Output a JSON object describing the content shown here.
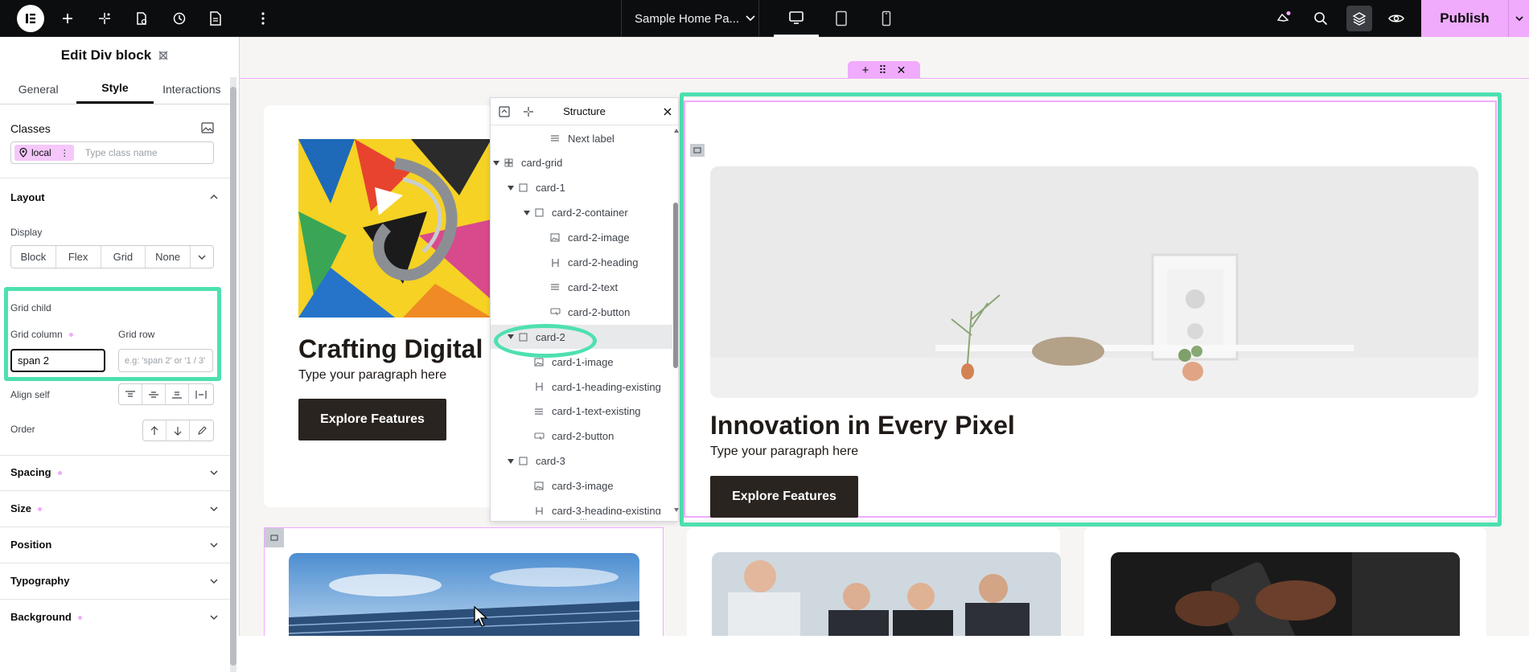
{
  "topbar": {
    "page_name": "Sample Home Pa...",
    "publish_label": "Publish",
    "icons": [
      "elementor-logo-icon",
      "add-icon",
      "ai-sparkle-icon",
      "page-settings-icon",
      "history-icon",
      "document-icon",
      "more-vertical-icon",
      "chevron-down-icon",
      "desktop-icon",
      "tablet-icon",
      "mobile-icon",
      "whats-new-icon",
      "search-icon",
      "layers-icon",
      "preview-eye-icon"
    ]
  },
  "panel": {
    "title": "Edit Div block",
    "tabs": [
      "General",
      "Style",
      "Interactions"
    ],
    "classes_label": "Classes",
    "class_chip": "local",
    "class_placeholder": "Type class name",
    "layout_label": "Layout",
    "display_label": "Display",
    "display_options": [
      "Block",
      "Flex",
      "Grid",
      "None"
    ],
    "grid_child_label": "Grid child",
    "grid_column_label": "Grid column",
    "grid_column_value": "span 2",
    "grid_row_label": "Grid row",
    "grid_row_placeholder": "e.g: 'span 2' or '1 / 3'",
    "align_self_label": "Align self",
    "order_label": "Order",
    "sections": [
      "Spacing",
      "Size",
      "Position",
      "Typography",
      "Background"
    ]
  },
  "structure": {
    "title": "Structure",
    "items": [
      {
        "label": "Next label",
        "icon": "text-icon",
        "level": 3,
        "caret": false
      },
      {
        "label": "card-grid",
        "icon": "grid-icon",
        "level": 0,
        "caret": true
      },
      {
        "label": "card-1",
        "icon": "div-icon",
        "level": 1,
        "caret": true
      },
      {
        "label": "card-2-container",
        "icon": "div-icon",
        "level": 2,
        "caret": true
      },
      {
        "label": "card-2-image",
        "icon": "image-icon",
        "level": 3,
        "caret": false
      },
      {
        "label": "card-2-heading",
        "icon": "heading-icon",
        "level": 3,
        "caret": false
      },
      {
        "label": "card-2-text",
        "icon": "text-icon",
        "level": 3,
        "caret": false
      },
      {
        "label": "card-2-button",
        "icon": "button-icon",
        "level": 3,
        "caret": false
      },
      {
        "label": "card-2",
        "icon": "div-icon",
        "level": 1,
        "caret": true,
        "selected": true
      },
      {
        "label": "card-1-image",
        "icon": "image-icon",
        "level": 2,
        "caret": false
      },
      {
        "label": "card-1-heading-existing",
        "icon": "heading-icon",
        "level": 2,
        "caret": false
      },
      {
        "label": "card-1-text-existing",
        "icon": "text-icon",
        "level": 2,
        "caret": false
      },
      {
        "label": "card-2-button",
        "icon": "button-icon",
        "level": 2,
        "caret": false
      },
      {
        "label": "card-3",
        "icon": "div-icon",
        "level": 1,
        "caret": true
      },
      {
        "label": "card-3-image",
        "icon": "image-icon",
        "level": 2,
        "caret": false
      },
      {
        "label": "card-3-heading-existing",
        "icon": "heading-icon",
        "level": 2,
        "caret": false
      }
    ]
  },
  "canvas": {
    "card1": {
      "heading": "Crafting Digital E",
      "text": "Type your paragraph here",
      "button": "Explore Features"
    },
    "card2": {
      "heading": "Innovation in Every Pixel",
      "text": "Type your paragraph here",
      "button": "Explore Features"
    }
  },
  "colors": {
    "accent": "#f0abfc",
    "highlight": "#4ee0b0",
    "dark_button": "#2a2420",
    "topbar": "#0c0d0e"
  }
}
